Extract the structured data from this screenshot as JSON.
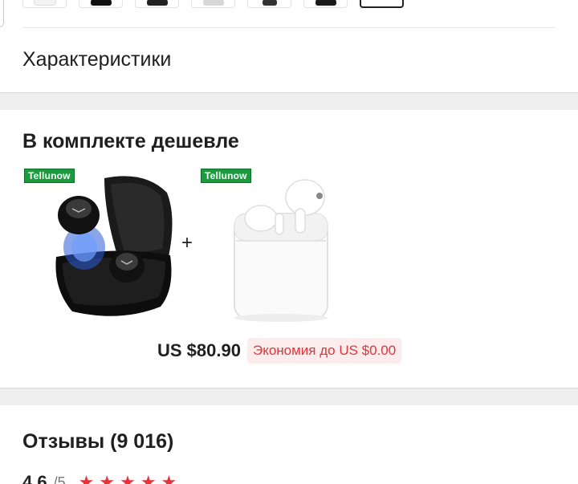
{
  "specs": {
    "title": "Характеристики"
  },
  "bundle": {
    "title": "В комплекте дешевле",
    "products": [
      {
        "brand": "Tellunow",
        "image": "black-earbuds-case"
      },
      {
        "brand": "Tellunow",
        "image": "white-earbuds-case"
      }
    ],
    "plus": "+",
    "price": "US $80.90",
    "savings": "Экономия до US $0.00"
  },
  "reviews": {
    "title": "Отзывы (9 016)",
    "rating": "4.6",
    "rating_of": "/5",
    "stars": 5
  },
  "colors": {
    "accent_red": "#e2343b",
    "brand_green": "#1a9c3e",
    "band_gray": "#eeeeee"
  }
}
